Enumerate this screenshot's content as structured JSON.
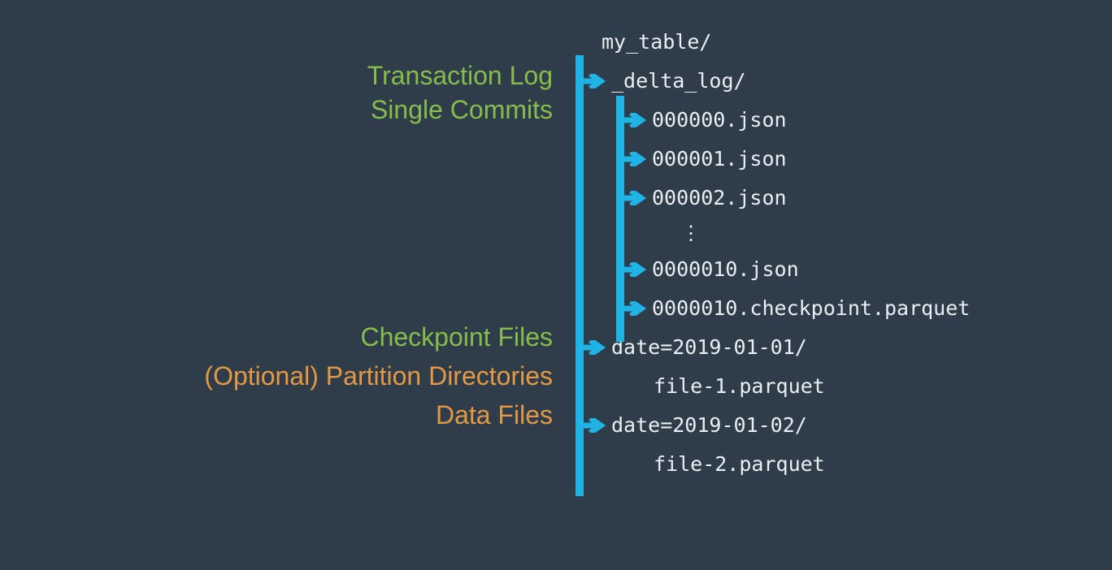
{
  "labels": {
    "transaction_log": "Transaction Log",
    "single_commits": "Single Commits",
    "checkpoint_files": "Checkpoint Files",
    "partition_dirs": "(Optional) Partition Directories",
    "data_files": "Data Files"
  },
  "tree": {
    "root": "my_table/",
    "delta_log": "_delta_log/",
    "commits": [
      "000000.json",
      "000001.json",
      "000002.json"
    ],
    "ellipsis": "⋮",
    "last_commit": "0000010.json",
    "checkpoint": "0000010.checkpoint.parquet",
    "partitions": [
      {
        "dir": "date=2019-01-01/",
        "file": "file-1.parquet"
      },
      {
        "dir": "date=2019-01-02/",
        "file": "file-2.parquet"
      }
    ]
  },
  "colors": {
    "bg": "#2f3d4a",
    "arrow": "#1fb3e6",
    "green": "#86bc4c",
    "orange": "#e39843",
    "text": "#e9eef2"
  }
}
